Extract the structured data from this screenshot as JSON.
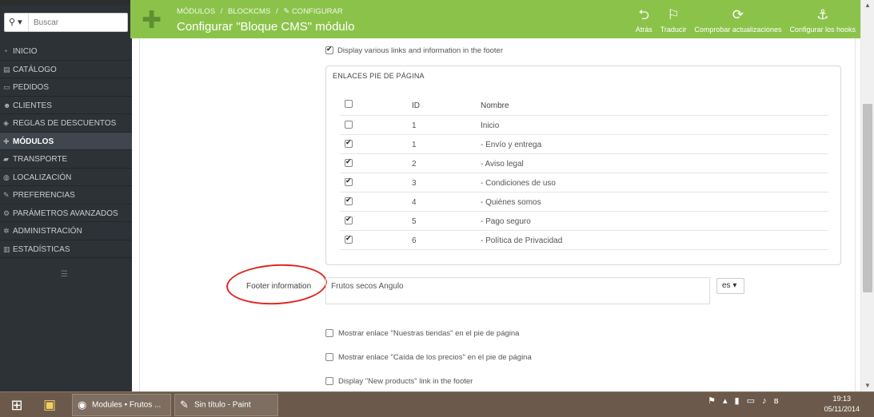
{
  "search": {
    "placeholder": "Buscar"
  },
  "sidebar": {
    "items": [
      {
        "label": "INICIO",
        "icon": "dashboard-icon",
        "glyph": "◔"
      },
      {
        "label": "CATÁLOGO",
        "icon": "catalog-icon",
        "glyph": "▤"
      },
      {
        "label": "PEDIDOS",
        "icon": "orders-icon",
        "glyph": "▭"
      },
      {
        "label": "CLIENTES",
        "icon": "customers-icon",
        "glyph": "☻"
      },
      {
        "label": "REGLAS DE DESCUENTOS",
        "icon": "discount-icon",
        "glyph": "◈"
      },
      {
        "label": "MÓDULOS",
        "icon": "modules-icon",
        "glyph": "✚",
        "active": true
      },
      {
        "label": "TRANSPORTE",
        "icon": "truck-icon",
        "glyph": "▰"
      },
      {
        "label": "LOCALIZACIÓN",
        "icon": "globe-icon",
        "glyph": "◍"
      },
      {
        "label": "PREFERENCIAS",
        "icon": "wrench-icon",
        "glyph": "✎"
      },
      {
        "label": "PARÁMETROS AVANZADOS",
        "icon": "cogs-icon",
        "glyph": "⚙"
      },
      {
        "label": "ADMINISTRACIÓN",
        "icon": "gear-icon",
        "glyph": "✲"
      },
      {
        "label": "ESTADÍSTICAS",
        "icon": "stats-icon",
        "glyph": "▥"
      }
    ]
  },
  "header": {
    "breadcrumb": [
      "MÓDULOS",
      "/",
      "BLOCKCMS",
      "/",
      "✎ CONFIGURAR"
    ],
    "title": "Configurar \"Bloque CMS\" módulo",
    "toolbar": [
      {
        "label": "Atrás",
        "icon": "back-icon",
        "glyph": "⮌"
      },
      {
        "label": "Traducir",
        "icon": "flag-icon",
        "glyph": "⚐"
      },
      {
        "label": "Comprobar actualizaciones",
        "icon": "refresh-icon",
        "glyph": "⟳"
      },
      {
        "label": "Configurar los hooks",
        "icon": "anchor-icon",
        "glyph": "⚓"
      }
    ]
  },
  "main": {
    "display_links_label": "Display various links and information in the footer",
    "footer_links": {
      "title": "ENLACES PIE DE PÁGINA",
      "columns": [
        "ID",
        "Nombre"
      ],
      "rows": [
        {
          "id": "1",
          "name": "Inicio",
          "checked": false
        },
        {
          "id": "1",
          "name": "- Envío y entrega",
          "checked": true
        },
        {
          "id": "2",
          "name": "- Aviso legal",
          "checked": true
        },
        {
          "id": "3",
          "name": "- Condiciones de uso",
          "checked": true
        },
        {
          "id": "4",
          "name": "- Quiénes somos",
          "checked": true
        },
        {
          "id": "5",
          "name": "- Pago seguro",
          "checked": true
        },
        {
          "id": "6",
          "name": "- Política de Privacidad",
          "checked": true
        }
      ]
    },
    "footer_info": {
      "label": "Footer information",
      "value": "Frutos secos Angulo",
      "lang": "es ▾"
    },
    "options": [
      {
        "label": "Mostrar enlace \"Nuestras tiendas\" en el pie de página"
      },
      {
        "label": "Mostrar enlace \"Caída de los precios\" en el pie de página"
      },
      {
        "label": "Display \"New products\" link in the footer"
      }
    ]
  },
  "taskbar": {
    "tasks": [
      {
        "label": "Modules • Frutos ...",
        "icon": "chrome-icon"
      },
      {
        "label": "Sin título - Paint",
        "icon": "paint-icon"
      }
    ],
    "clock": {
      "time": "19:13",
      "date": "05/11/2014"
    }
  },
  "colors": {
    "header_green": "#8bc34a",
    "sidebar_bg": "#2d3237",
    "annotation_red": "#e0261f"
  }
}
